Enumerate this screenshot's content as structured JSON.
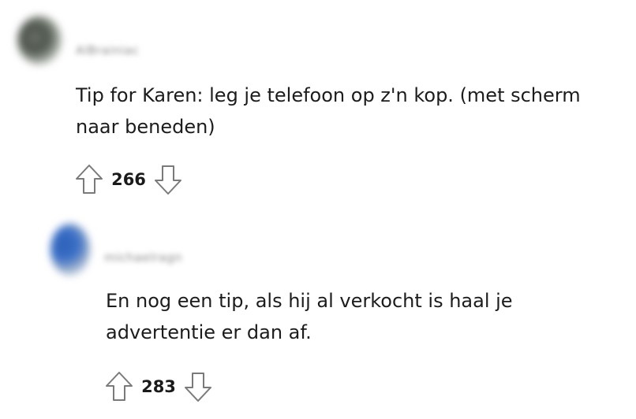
{
  "comments": [
    {
      "username": "AlBrainiac",
      "avatar_color": "#4d544c",
      "text_lines": [
        "Tip for Karen: leg je telefoon op z'n kop. (met scherm",
        "naar beneden)"
      ],
      "score": "266",
      "upvote_icon": "arrow-up-outline-icon",
      "downvote_icon": "arrow-down-outline-icon"
    },
    {
      "username": "michaelragn",
      "avatar_color": "#3a70c8",
      "text_lines": [
        "En nog een tip, als hij al verkocht is haal je",
        "advertentie er dan af."
      ],
      "score": "283",
      "upvote_icon": "arrow-up-outline-icon",
      "downvote_icon": "arrow-down-outline-icon"
    }
  ]
}
